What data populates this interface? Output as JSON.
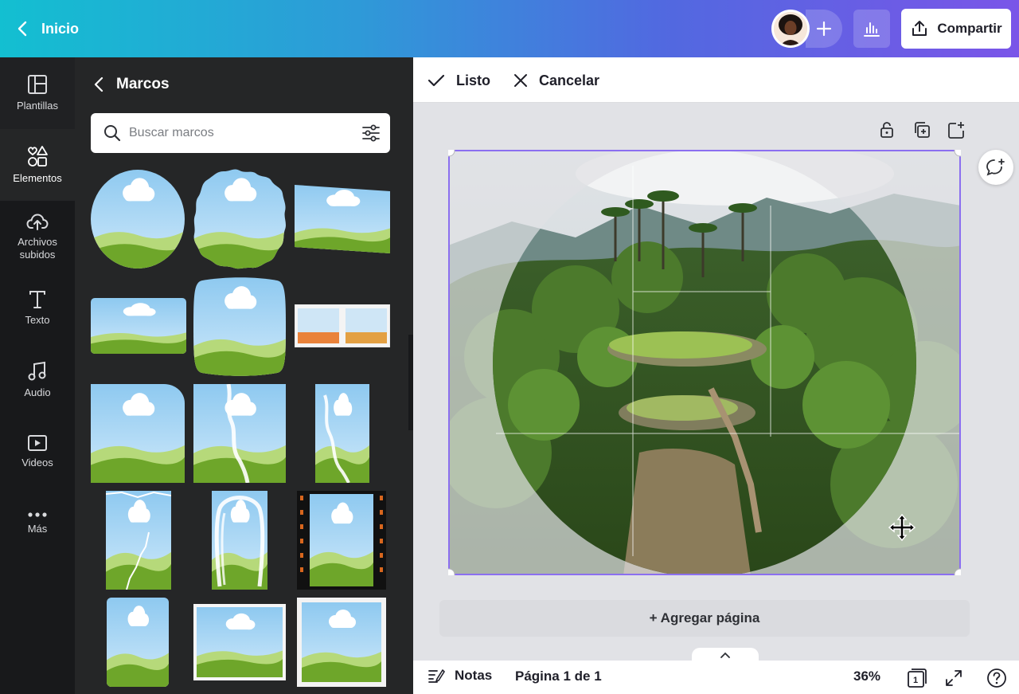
{
  "header": {
    "back_label": "Inicio",
    "share_label": "Compartir"
  },
  "rail": [
    {
      "label": "Plantillas",
      "icon": "layout-icon"
    },
    {
      "label": "Elementos",
      "icon": "shapes-icon"
    },
    {
      "label": "Archivos\nsubidos",
      "icon": "cloud-upload-icon"
    },
    {
      "label": "Texto",
      "icon": "text-icon"
    },
    {
      "label": "Audio",
      "icon": "music-note-icon"
    },
    {
      "label": "Videos",
      "icon": "play-icon"
    },
    {
      "label": "Más",
      "icon": "more-dots-icon"
    }
  ],
  "panel": {
    "title": "Marcos",
    "search_placeholder": "Buscar marcos"
  },
  "crop_bar": {
    "done_label": "Listo",
    "cancel_label": "Cancelar"
  },
  "canvas": {
    "add_page_label": "+ Agregar página"
  },
  "footer": {
    "notes_label": "Notas",
    "page_label": "Página 1 de 1",
    "zoom": "36%",
    "page_count": "1"
  },
  "colors": {
    "accent": "#8b3dff",
    "selection": "#8b6ff0",
    "sky": "#9fd0f2",
    "grass": "#6ea62a"
  }
}
